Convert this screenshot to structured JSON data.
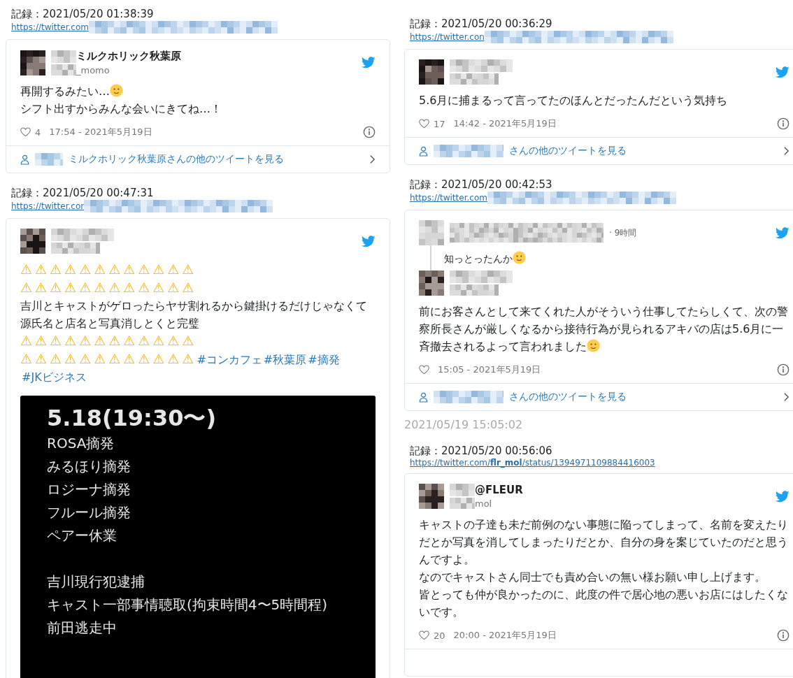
{
  "columns": [
    {
      "records": [
        {
          "label": "記録：2021/05/20 01:38:39",
          "link": {
            "url": "https://twitter.com",
            "redacted": true
          },
          "tweet": {
            "author": {
              "name": "ミルクホリック秋葉原",
              "handle": "_momo",
              "redacted": true
            },
            "body": [
              [
                {
                  "kind": "text",
                  "text": "再開するみたい…"
                },
                {
                  "kind": "emoji"
                }
              ],
              [
                {
                  "kind": "text",
                  "text": "シフト出すからみんな会いにきてね…！"
                }
              ]
            ],
            "likes": "4",
            "time": "17:54 - 2021年5月19日",
            "more": {
              "text": "ミルクホリック秋葉原さんの他のツイートを見る",
              "redacted": true
            }
          }
        },
        {
          "label": "記録：2021/05/20 00:47:31",
          "link": {
            "url": "https://twitter.cor",
            "redacted": true
          },
          "tweet": {
            "author": {
              "redacted": true
            },
            "body": [
              [
                {
                  "kind": "warn",
                  "text": "⚠⚠⚠⚠⚠⚠⚠⚠⚠⚠⚠⚠"
                }
              ],
              [
                {
                  "kind": "warn",
                  "text": "⚠⚠⚠⚠⚠⚠⚠⚠⚠⚠⚠⚠"
                }
              ],
              [
                {
                  "kind": "text",
                  "text": "吉川とキャストがゲロったらヤサ割れるから鍵掛けるだけじゃなくて"
                }
              ],
              [
                {
                  "kind": "text",
                  "text": "源氏名と店名と写真消しとくと完璧"
                }
              ],
              [
                {
                  "kind": "warn",
                  "text": "⚠⚠⚠⚠⚠⚠⚠⚠⚠⚠⚠⚠"
                }
              ],
              [
                {
                  "kind": "warn",
                  "text": "⚠⚠⚠⚠⚠⚠⚠⚠⚠⚠⚠⚠"
                },
                {
                  "kind": "tag",
                  "text": "#コンカフェ"
                },
                {
                  "kind": "tag",
                  "text": "#秋葉原"
                },
                {
                  "kind": "tag",
                  "text": "#摘発"
                },
                {
                  "kind": "tag",
                  "text": "#JKビジネス"
                }
              ]
            ],
            "attachment": {
              "kind": "screenshot",
              "title": "5.18(19:30〜)",
              "sections": [
                [
                  "ROSA摘発",
                  "みるほり摘発",
                  "ロジーナ摘発",
                  "フルール摘発",
                  "ペアー休業"
                ],
                [
                  "吉川現行犯逮捕",
                  "キャスト一部事情聴取(拘束時間4〜5時間程)",
                  "前田逃走中"
                ]
              ]
            }
          }
        }
      ]
    },
    {
      "records": [
        {
          "label": "記録：2021/05/20 00:36:29",
          "link": {
            "url": "https://twitter.con",
            "redacted": true
          },
          "tweet": {
            "author": {
              "redacted": true
            },
            "body": [
              [
                {
                  "kind": "text",
                  "text": "5.6月に捕まるって言ってたのほんとだったんだという気持ち"
                }
              ]
            ],
            "likes": "17",
            "time": "14:42 - 2021年5月19日",
            "more": {
              "text": "さんの他のツイートを見る",
              "redacted": true
            }
          }
        },
        {
          "label": "記録：2021/05/20 00:42:53",
          "link": {
            "url": "https://twitter.com",
            "redacted": true
          },
          "tweet": {
            "thread": {
              "redacted": true,
              "age": "· 9時間",
              "body": [
                {
                  "kind": "text",
                  "text": "知っとったんか"
                },
                {
                  "kind": "emoji"
                }
              ]
            },
            "author": {
              "redacted": true
            },
            "body": [
              [
                {
                  "kind": "text",
                  "text": "前にお客さんとして来てくれた人がそういう仕事してたらしくて、次の警察所長さんが厳しくなるから接待行為が見られるアキバの店は5.6月に一斉撤去されるよって言われました"
                },
                {
                  "kind": "emoji"
                }
              ]
            ],
            "time": "15:05 - 2021年5月19日",
            "more": {
              "text": "さんの他のツイートを見る",
              "redacted": true
            }
          },
          "caption": "2021/05/19 15:05:02"
        },
        {
          "label": "記録：2021/05/20 00:56:06",
          "link": {
            "url": "https://twitter.com/**flr_mol**/status/1394971109884416003",
            "redacted": false
          },
          "tweet": {
            "author": {
              "name": "@FLEUR",
              "handle": "mol",
              "redacted": true
            },
            "body": [
              [
                {
                  "kind": "text",
                  "text": "キャストの子達も未だ前例のない事態に陥ってしまって、名前を変えたりだとか写真を消してしまったりだとか、自分の身を案じていたのだと思うんですよ。"
                }
              ],
              [
                {
                  "kind": "text",
                  "text": "なのでキャストさん同士でも責め合いの無い様お願い申し上げます。"
                }
              ],
              [
                {
                  "kind": "text",
                  "text": "皆とっても仲が良かったのに、此度の件で居心地の悪いお店にはしたくないです。"
                }
              ]
            ],
            "likes": "20",
            "time": "20:00 - 2021年5月19日"
          }
        }
      ]
    }
  ]
}
